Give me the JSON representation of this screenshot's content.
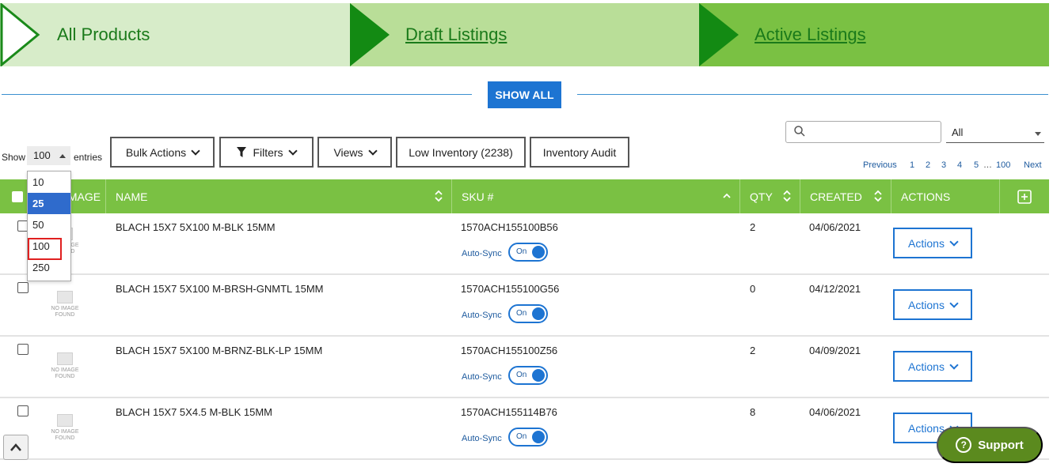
{
  "steps": [
    {
      "label": "All Products"
    },
    {
      "label": "Draft Listings"
    },
    {
      "label": "Active Listings"
    }
  ],
  "show_all_label": "SHOW ALL",
  "search": {
    "placeholder": ""
  },
  "filter_select": {
    "value": "All"
  },
  "page_length": {
    "show_label": "Show",
    "entries_label": "entries",
    "value": "100",
    "options": [
      "10",
      "25",
      "50",
      "100",
      "250"
    ],
    "highlighted": "25",
    "marked": "100"
  },
  "toolbar": {
    "bulk_actions": "Bulk Actions",
    "filters": "Filters",
    "views": "Views",
    "low_inventory": "Low Inventory (2238)",
    "inventory_audit": "Inventory Audit"
  },
  "pagination": {
    "previous": "Previous",
    "pages": [
      "1",
      "2",
      "3",
      "4",
      "5"
    ],
    "ellipsis": "…",
    "last": "100",
    "next": "Next"
  },
  "columns": {
    "image": "IMAGE",
    "name": "NAME",
    "sku": "SKU #",
    "qty": "QTY",
    "created": "CREATED",
    "actions": "ACTIONS"
  },
  "no_image_text": "NO IMAGE FOUND",
  "auto_sync_label": "Auto-Sync",
  "toggle_on": "On",
  "actions_label": "Actions",
  "rows": [
    {
      "name": "BLACH 15X7 5X100 M-BLK 15MM",
      "sku": "1570ACH155100B56",
      "qty": "2",
      "created": "04/06/2021"
    },
    {
      "name": "BLACH 15X7 5X100 M-BRSH-GNMTL 15MM",
      "sku": "1570ACH155100G56",
      "qty": "0",
      "created": "04/12/2021"
    },
    {
      "name": "BLACH 15X7 5X100 M-BRNZ-BLK-LP 15MM",
      "sku": "1570ACH155100Z56",
      "qty": "2",
      "created": "04/09/2021"
    },
    {
      "name": "BLACH 15X7 5X4.5 M-BLK 15MM",
      "sku": "1570ACH155114B76",
      "qty": "8",
      "created": "04/06/2021"
    }
  ],
  "support_label": "Support",
  "colors": {
    "green": "#7ac143",
    "dark_green": "#1a7a1a",
    "blue": "#1d74d2",
    "support": "#5b8a1e"
  }
}
